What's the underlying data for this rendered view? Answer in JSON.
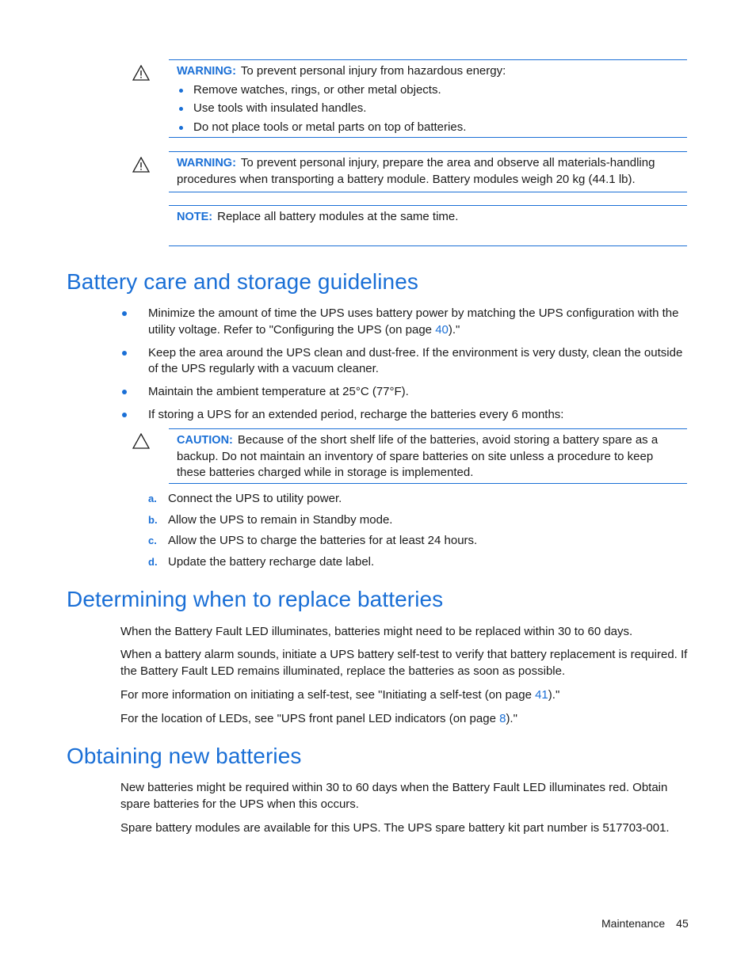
{
  "notices": [
    {
      "type": "warning",
      "icon": "warning-triangle-icon",
      "label": "WARNING:",
      "text": "To prevent personal injury from hazardous energy:",
      "items": [
        "Remove watches, rings, or other metal objects.",
        "Use tools with insulated handles.",
        "Do not place tools or metal parts on top of batteries."
      ]
    },
    {
      "type": "warning",
      "icon": "warning-triangle-icon",
      "label": "WARNING:",
      "text": "To prevent personal injury, prepare the area and observe all materials-handling procedures when transporting a battery module. Battery modules weigh 20 kg (44.1 lb)."
    },
    {
      "type": "note",
      "label": "NOTE:",
      "text": "Replace all battery modules at the same time."
    }
  ],
  "sections": {
    "care": {
      "title": "Battery care and storage guidelines",
      "bullets": [
        {
          "before": "Minimize the amount of time the UPS uses battery power by matching the UPS configuration with the utility voltage. Refer to \"Configuring the UPS (on page ",
          "link": "40",
          "after": ").\""
        },
        {
          "before": "Keep the area around the UPS clean and dust-free. If the environment is very dusty, clean the outside of the UPS regularly with a vacuum cleaner.",
          "link": "",
          "after": ""
        },
        {
          "before": "Maintain the ambient temperature at 25°C (77°F).",
          "link": "",
          "after": ""
        },
        {
          "before": "If storing a UPS for an extended period, recharge the batteries every 6 months:",
          "link": "",
          "after": ""
        }
      ],
      "caution": {
        "icon": "caution-triangle-icon",
        "label": "CAUTION:",
        "text": "Because of the short shelf life of the batteries, avoid storing a battery spare as a backup. Do not maintain an inventory of spare batteries on site unless a procedure to keep these batteries charged while in storage is implemented."
      },
      "steps": [
        {
          "letter": "a.",
          "text": "Connect the UPS to utility power."
        },
        {
          "letter": "b.",
          "text": "Allow the UPS to remain in Standby mode."
        },
        {
          "letter": "c.",
          "text": "Allow the UPS to charge the batteries for at least 24 hours."
        },
        {
          "letter": "d.",
          "text": "Update the battery recharge date label."
        }
      ]
    },
    "replace": {
      "title": "Determining when to replace batteries",
      "p1": "When the Battery Fault LED illuminates, batteries might need to be replaced within 30 to 60 days.",
      "p2": "When a battery alarm sounds, initiate a UPS battery self-test to verify that battery replacement is required. If the Battery Fault LED remains illuminated, replace the batteries as soon as possible.",
      "p3": {
        "before": "For more information on initiating a self-test, see \"Initiating a self-test (on page ",
        "link": "41",
        "after": ").\""
      },
      "p4": {
        "before": "For the location of LEDs, see \"UPS front panel LED indicators (on page ",
        "link": "8",
        "after": ").\""
      }
    },
    "obtain": {
      "title": "Obtaining new batteries",
      "p1": "New batteries might be required within 30 to 60 days when the Battery Fault LED illuminates red. Obtain spare batteries for the UPS when this occurs.",
      "p2": "Spare battery modules are available for this UPS. The UPS spare battery kit part number is 517703-001."
    }
  },
  "footer": {
    "section": "Maintenance",
    "page": "45"
  },
  "colors": {
    "accent": "#1a6fd6",
    "text": "#1a1a1a"
  }
}
